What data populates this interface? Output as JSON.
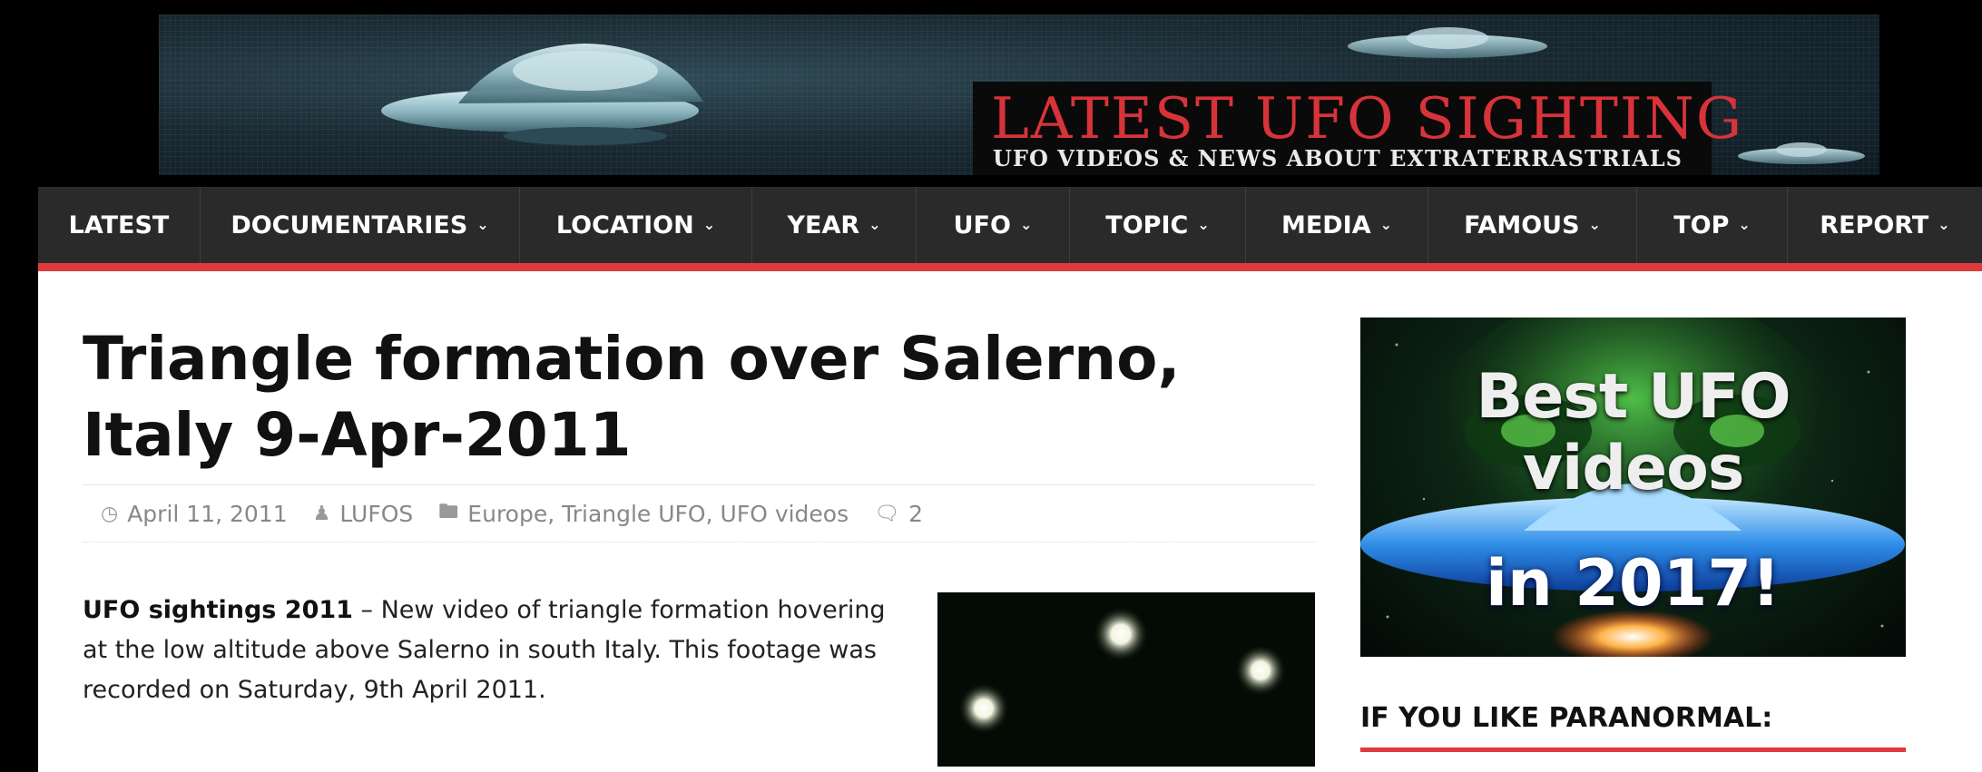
{
  "banner": {
    "title": "LATEST UFO SIGHTING",
    "subtitle": "UFO VIDEOS & NEWS ABOUT EXTRATERRASTRIALS"
  },
  "nav": {
    "items": [
      {
        "label": "LATEST",
        "has_dropdown": false
      },
      {
        "label": "DOCUMENTARIES",
        "has_dropdown": true
      },
      {
        "label": "LOCATION",
        "has_dropdown": true
      },
      {
        "label": "YEAR",
        "has_dropdown": true
      },
      {
        "label": "UFO",
        "has_dropdown": true
      },
      {
        "label": "TOPIC",
        "has_dropdown": true
      },
      {
        "label": "MEDIA",
        "has_dropdown": true
      },
      {
        "label": "FAMOUS",
        "has_dropdown": true
      },
      {
        "label": "TOP",
        "has_dropdown": true
      },
      {
        "label": "REPORT",
        "has_dropdown": true
      }
    ]
  },
  "post": {
    "title": "Triangle formation over Salerno, Italy 9-Apr-2011",
    "date": "April 11, 2011",
    "author": "LUFOS",
    "categories": [
      "Europe",
      "Triangle UFO",
      "UFO videos"
    ],
    "comments": "2",
    "excerpt_lead": "UFO sightings 2011",
    "excerpt_body": " – New video of triangle formation hovering at the low altitude above Salerno in south Italy. This footage was recorded on Saturday, 9th April 2011."
  },
  "sidebar": {
    "ad_title": "Best UFO videos",
    "ad_subtitle": "in 2017!",
    "widget_title": "IF YOU LIKE PARANORMAL:"
  },
  "colors": {
    "accent": "#e03a3e",
    "nav_bg": "#2a2a2a",
    "banner_title": "#d8333a"
  },
  "icons": {
    "date": "clock-icon",
    "author": "user-icon",
    "categories": "folder-icon",
    "comments": "comment-icon",
    "dropdown": "chevron-down-icon"
  }
}
